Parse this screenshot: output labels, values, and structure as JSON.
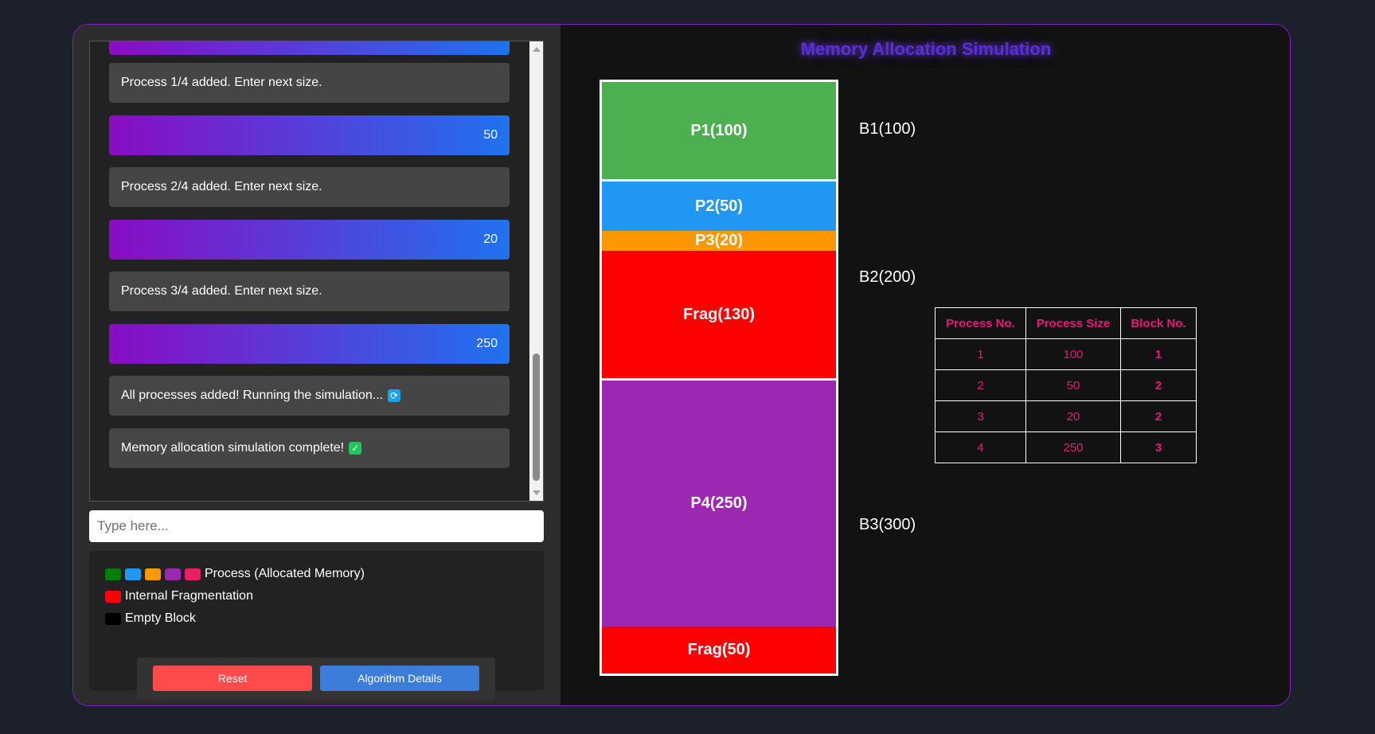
{
  "chat": {
    "messages": [
      {
        "role": "user",
        "text": ""
      },
      {
        "role": "bot",
        "text": "Process 1/4 added. Enter next size."
      },
      {
        "role": "user",
        "text": "50"
      },
      {
        "role": "bot",
        "text": "Process 2/4 added. Enter next size."
      },
      {
        "role": "user",
        "text": "20"
      },
      {
        "role": "bot",
        "text": "Process 3/4 added. Enter next size."
      },
      {
        "role": "user",
        "text": "250"
      },
      {
        "role": "bot",
        "text": "All processes added! Running the simulation...",
        "emoji": "refresh-emoji-icon"
      },
      {
        "role": "bot",
        "text": "Memory allocation simulation complete!",
        "emoji": "check-emoji-icon"
      }
    ]
  },
  "input": {
    "placeholder": "Type here...",
    "value": ""
  },
  "legend": {
    "process_label": "Process (Allocated Memory)",
    "process_colors": [
      "#008000",
      "#2196f3",
      "#ff9800",
      "#9c27b0",
      "#e91e63"
    ],
    "frag_label": "Internal Fragmentation",
    "frag_color": "#ff0000",
    "empty_label": "Empty Block",
    "empty_color": "#000000"
  },
  "buttons": {
    "reset": "Reset",
    "details": "Algorithm Details"
  },
  "title": "Memory Allocation Simulation",
  "memory": {
    "segments": [
      {
        "label": "P1(100)",
        "color": "#4caf50"
      },
      {
        "label": "P2(50)",
        "color": "#2196f3"
      },
      {
        "label": "P3(20)",
        "color": "#ff9800"
      },
      {
        "label": "Frag(130)",
        "color": "#ff0000"
      },
      {
        "label": "P4(250)",
        "color": "#9c27b0"
      },
      {
        "label": "Frag(50)",
        "color": "#ff0000"
      }
    ],
    "blocks": [
      "B1(100)",
      "B2(200)",
      "B3(300)"
    ]
  },
  "table": {
    "headers": [
      "Process No.",
      "Process Size",
      "Block No."
    ],
    "rows": [
      [
        "1",
        "100",
        "1"
      ],
      [
        "2",
        "50",
        "2"
      ],
      [
        "3",
        "20",
        "2"
      ],
      [
        "4",
        "250",
        "3"
      ]
    ]
  }
}
